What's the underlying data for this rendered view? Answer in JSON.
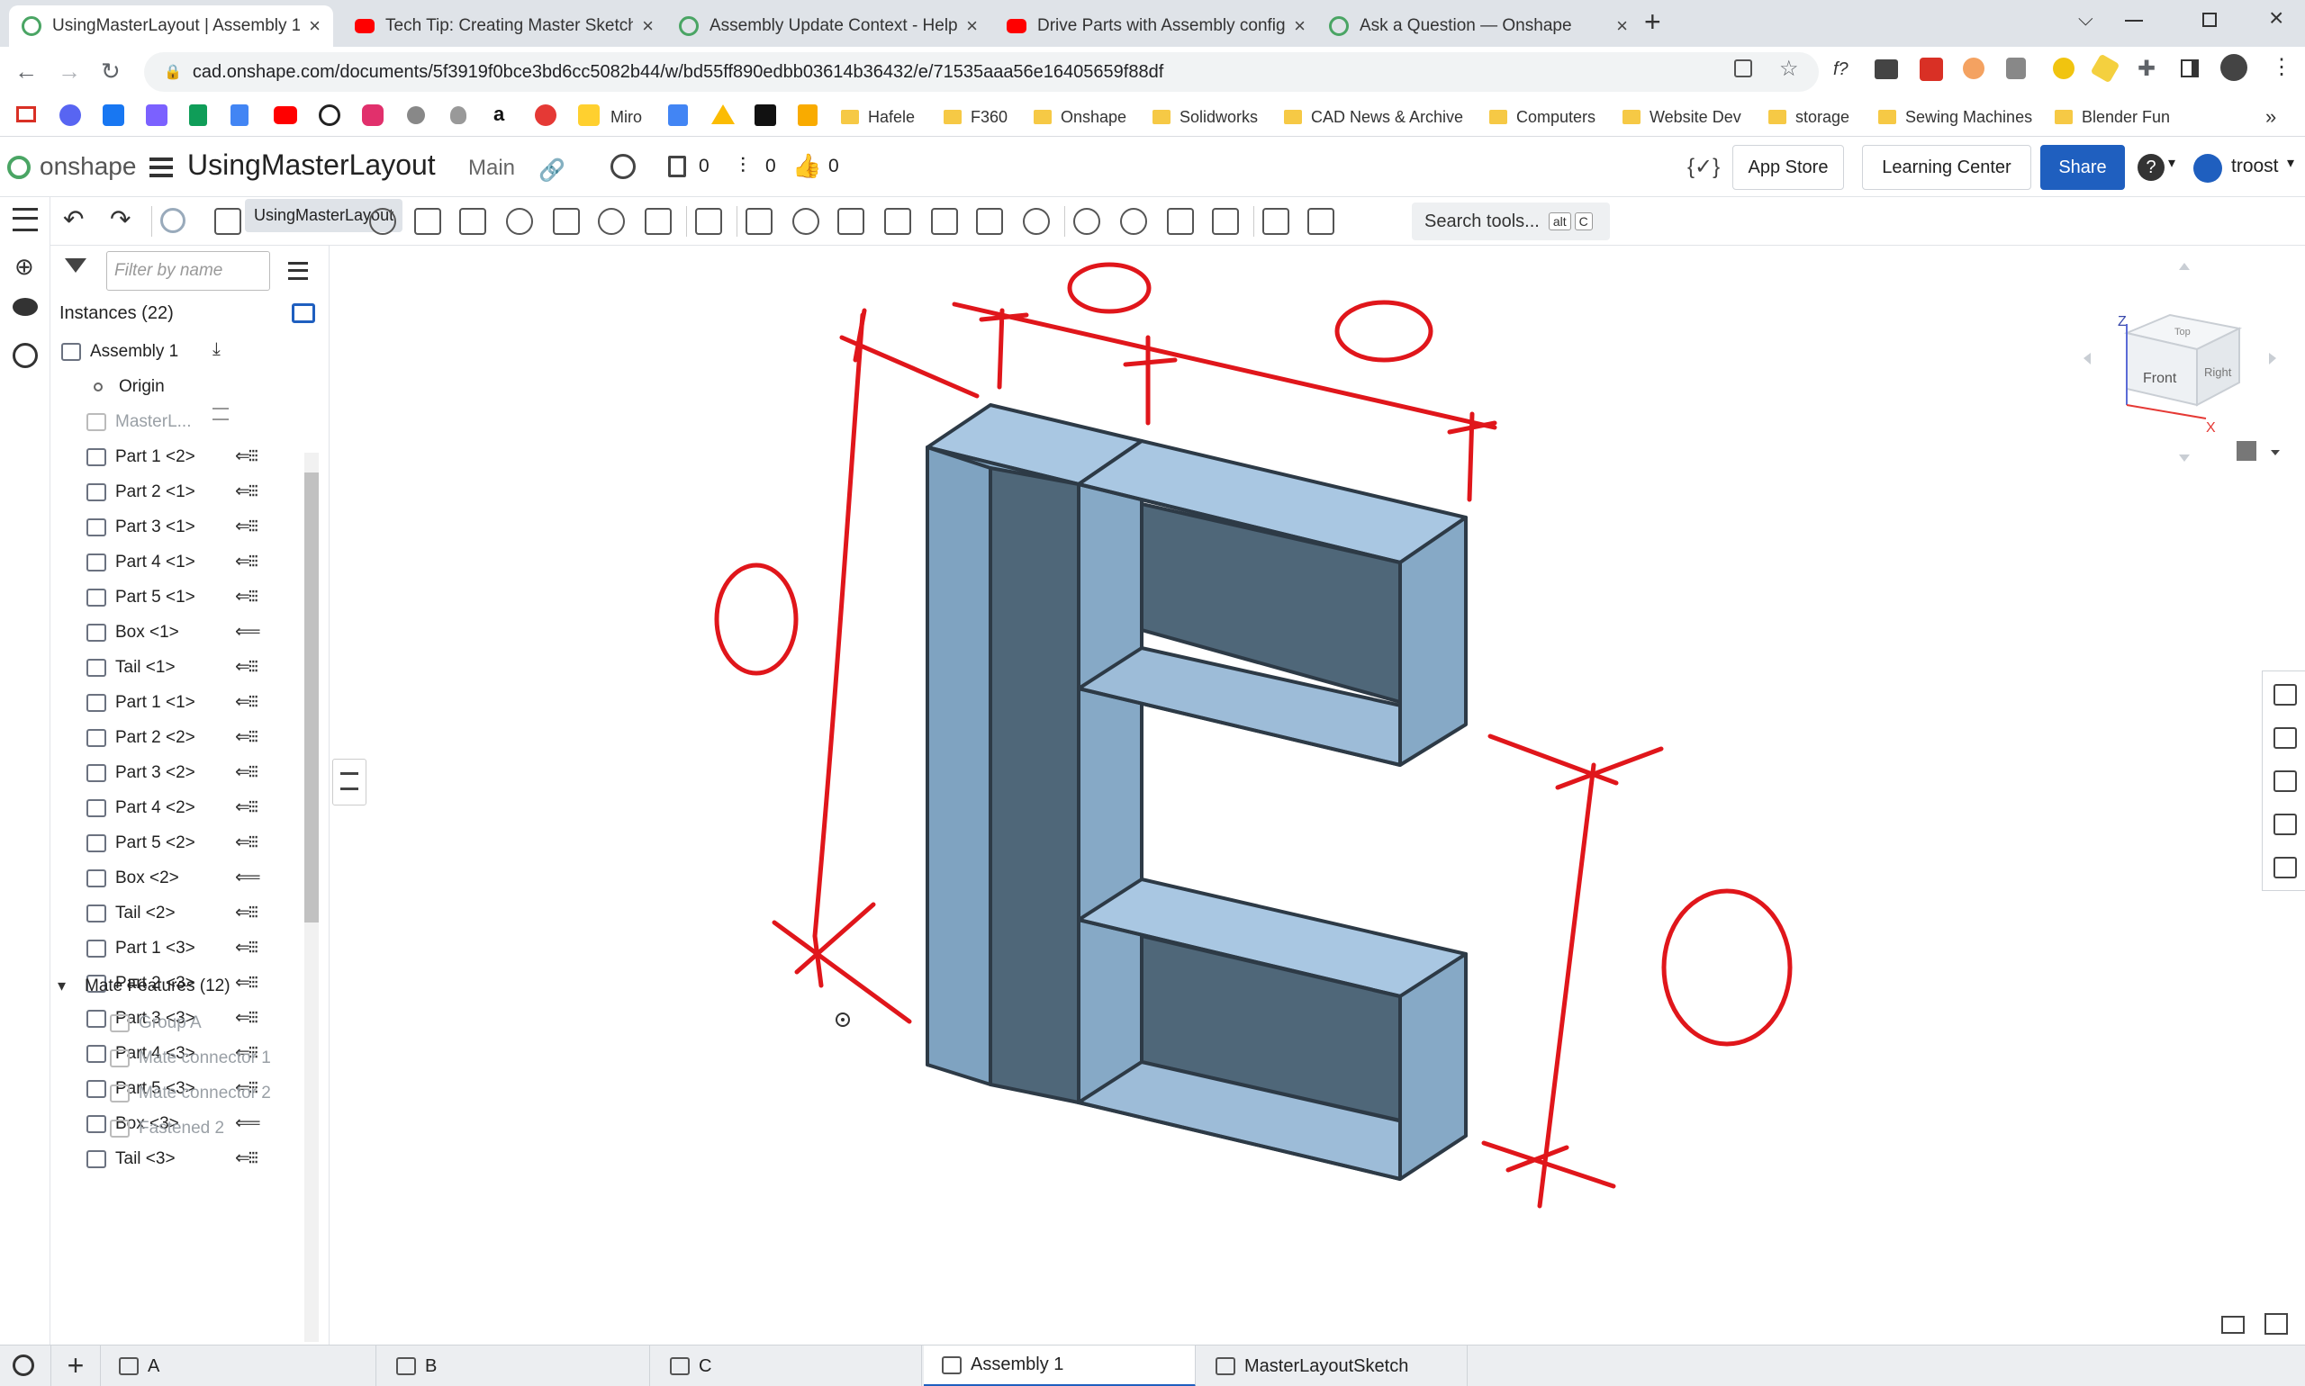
{
  "browser": {
    "tabs": [
      {
        "title": "UsingMasterLayout | Assembly 1",
        "active": true,
        "icon": "onshape-icon"
      },
      {
        "title": "Tech Tip: Creating Master Sketch",
        "active": false,
        "icon": "youtube-icon"
      },
      {
        "title": "Assembly Update Context - Help",
        "active": false,
        "icon": "onshape-icon"
      },
      {
        "title": "Drive Parts with Assembly config",
        "active": false,
        "icon": "youtube-icon"
      },
      {
        "title": "Ask a Question — Onshape",
        "active": false,
        "icon": "onshape-icon"
      }
    ],
    "tab_close": "×",
    "new_tab": "+",
    "url": "cad.onshape.com/documents/5f3919f0bce3bd6cc5082b44/w/bd55ff890edbb03614b36432/e/71535aaa56e16405659f88df",
    "bookmarks": [
      "Miro",
      "Hafele",
      "F360",
      "Onshape",
      "Solidworks",
      "CAD News & Archive",
      "Computers",
      "Website Dev",
      "storage",
      "Sewing Machines",
      "Blender Fun"
    ],
    "bookmarks_more": "»"
  },
  "header": {
    "logo_text": "onshape",
    "doc_title": "UsingMasterLayout",
    "branch": "Main",
    "tooltip": "UsingMasterLayout",
    "counts": {
      "versions": "0",
      "branches": "0",
      "likes": "0"
    },
    "app_store": "App Store",
    "learning_center": "Learning Center",
    "share": "Share",
    "help": "?",
    "user": "troost"
  },
  "toolbar": {
    "search_tools": "Search tools...",
    "shortcut_keys": [
      "alt",
      "C"
    ]
  },
  "panel": {
    "filter_placeholder": "Filter by name",
    "instances_header": "Instances (22)",
    "items": [
      {
        "label": "Assembly 1",
        "indent": 0,
        "dim": false,
        "mate": ""
      },
      {
        "label": "Origin",
        "indent": 1,
        "dim": false,
        "mate": ""
      },
      {
        "label": "MasterL...",
        "indent": 1,
        "dim": true,
        "mate": ""
      },
      {
        "label": "Part 1 <2>",
        "indent": 1,
        "dim": false,
        "mate": "⇐⁝⁝⁝"
      },
      {
        "label": "Part 2 <1>",
        "indent": 1,
        "dim": false,
        "mate": "⇐⁝⁝⁝"
      },
      {
        "label": "Part 3 <1>",
        "indent": 1,
        "dim": false,
        "mate": "⇐⁝⁝⁝"
      },
      {
        "label": "Part 4 <1>",
        "indent": 1,
        "dim": false,
        "mate": "⇐⁝⁝⁝"
      },
      {
        "label": "Part 5 <1>",
        "indent": 1,
        "dim": false,
        "mate": "⇐⁝⁝⁝"
      },
      {
        "label": "Box <1>",
        "indent": 1,
        "dim": false,
        "mate": "⟸"
      },
      {
        "label": "Tail <1>",
        "indent": 1,
        "dim": false,
        "mate": "⇐⁝⁝⁝"
      },
      {
        "label": "Part 1 <1>",
        "indent": 1,
        "dim": false,
        "mate": "⇐⁝⁝⁝"
      },
      {
        "label": "Part 2 <2>",
        "indent": 1,
        "dim": false,
        "mate": "⇐⁝⁝⁝"
      },
      {
        "label": "Part 3 <2>",
        "indent": 1,
        "dim": false,
        "mate": "⇐⁝⁝⁝"
      },
      {
        "label": "Part 4 <2>",
        "indent": 1,
        "dim": false,
        "mate": "⇐⁝⁝⁝"
      },
      {
        "label": "Part 5 <2>",
        "indent": 1,
        "dim": false,
        "mate": "⇐⁝⁝⁝"
      },
      {
        "label": "Box <2>",
        "indent": 1,
        "dim": false,
        "mate": "⟸"
      },
      {
        "label": "Tail <2>",
        "indent": 1,
        "dim": false,
        "mate": "⇐⁝⁝⁝"
      },
      {
        "label": "Part 1 <3>",
        "indent": 1,
        "dim": false,
        "mate": "⇐⁝⁝⁝"
      },
      {
        "label": "Part 2 <3>",
        "indent": 1,
        "dim": false,
        "mate": "⇐⁝⁝⁝"
      },
      {
        "label": "Part 3 <3>",
        "indent": 1,
        "dim": false,
        "mate": "⇐⁝⁝⁝"
      },
      {
        "label": "Part 4 <3>",
        "indent": 1,
        "dim": false,
        "mate": "⇐⁝⁝⁝"
      },
      {
        "label": "Part 5 <3>",
        "indent": 1,
        "dim": false,
        "mate": "⇐⁝⁝⁝"
      },
      {
        "label": "Box <3>",
        "indent": 1,
        "dim": false,
        "mate": "⟸"
      },
      {
        "label": "Tail <3>",
        "indent": 1,
        "dim": false,
        "mate": "⇐⁝⁝⁝"
      }
    ],
    "mate_features_header": "Mate Features (12)",
    "mate_features": [
      "Group A",
      "Mate connector 1",
      "Mate connector 2",
      "Fastened 2"
    ]
  },
  "viewcube": {
    "front": "Front",
    "right": "Right",
    "top": "Top",
    "axis_z": "Z",
    "axis_x": "X"
  },
  "bottom_tabs": [
    {
      "label": "A",
      "active": false
    },
    {
      "label": "B",
      "active": false
    },
    {
      "label": "C",
      "active": false
    },
    {
      "label": "Assembly 1",
      "active": true
    },
    {
      "label": "MasterLayoutSketch",
      "active": false
    }
  ],
  "colors": {
    "share_blue": "#1f5fbf",
    "part_fill": "#8fb3d1",
    "markup_red": "#e0161b"
  }
}
